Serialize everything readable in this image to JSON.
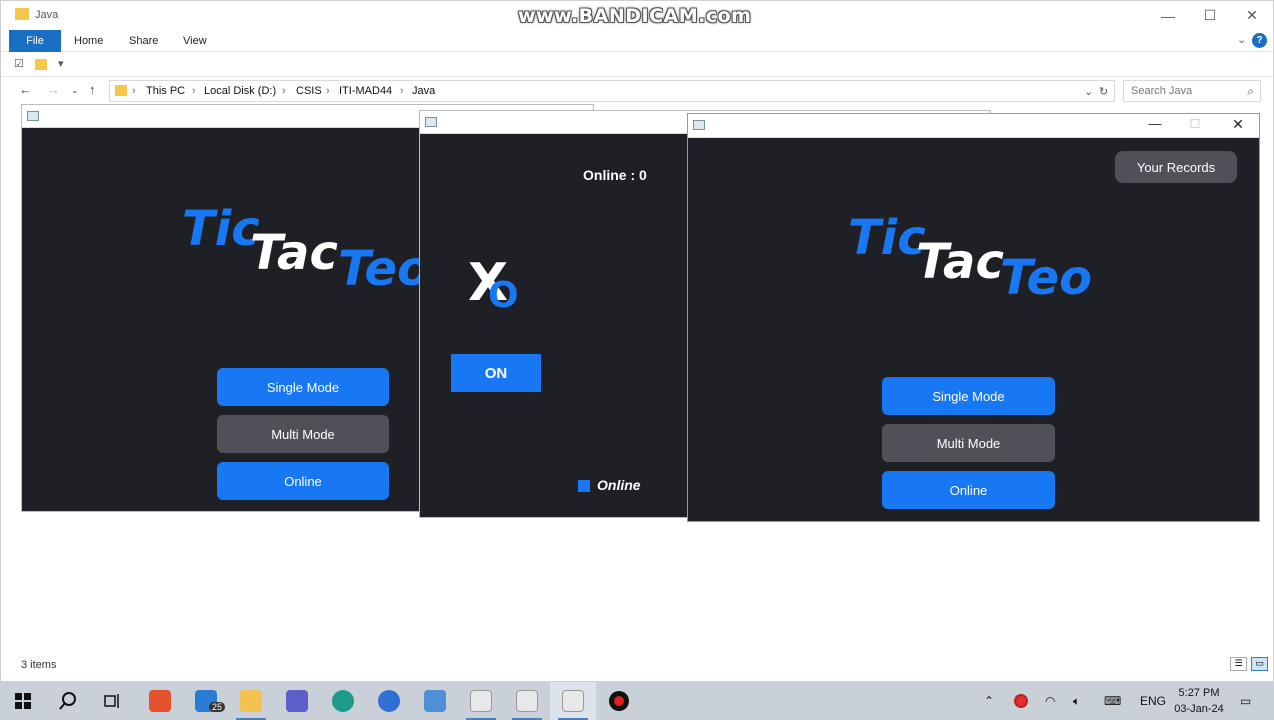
{
  "explorer": {
    "title": "Java",
    "ribbon_tabs": [
      "File",
      "Home",
      "Share",
      "View"
    ],
    "breadcrumb": [
      "This PC",
      "Local Disk (D:)",
      "CSIS",
      "ITI-MAD44",
      "Java"
    ],
    "search_placeholder": "Search Java",
    "status": "3 items",
    "controls": {
      "minimize": "—",
      "maximize": "☐",
      "close": "✕"
    }
  },
  "watermark": "www.BANDICAM.com",
  "game_left": {
    "logo": {
      "tic": "Tic",
      "tac": "Tac",
      "teo": "Teo"
    },
    "buttons": {
      "single": "Single Mode",
      "multi": "Multi Mode",
      "online": "Online"
    }
  },
  "game_middle": {
    "online_count": "Online : 0",
    "xo": {
      "x": "X",
      "o": "O"
    },
    "on_button": "ON",
    "legend": "Online"
  },
  "game_right": {
    "records_button": "Your Records",
    "logo": {
      "tic": "Tic",
      "tac": "Tac",
      "teo": "Teo"
    },
    "buttons": {
      "single": "Single Mode",
      "multi": "Multi Mode",
      "online": "Online"
    },
    "controls": {
      "minimize": "—",
      "maximize": "☐",
      "close": "✕"
    }
  },
  "colors": {
    "accent": "#1877f2",
    "panel": "#1f2025",
    "gray_button": "#505059"
  },
  "taskbar": {
    "mail_badge": "25",
    "language": "ENG",
    "time": "5:27 PM",
    "date": "03-Jan-24"
  }
}
